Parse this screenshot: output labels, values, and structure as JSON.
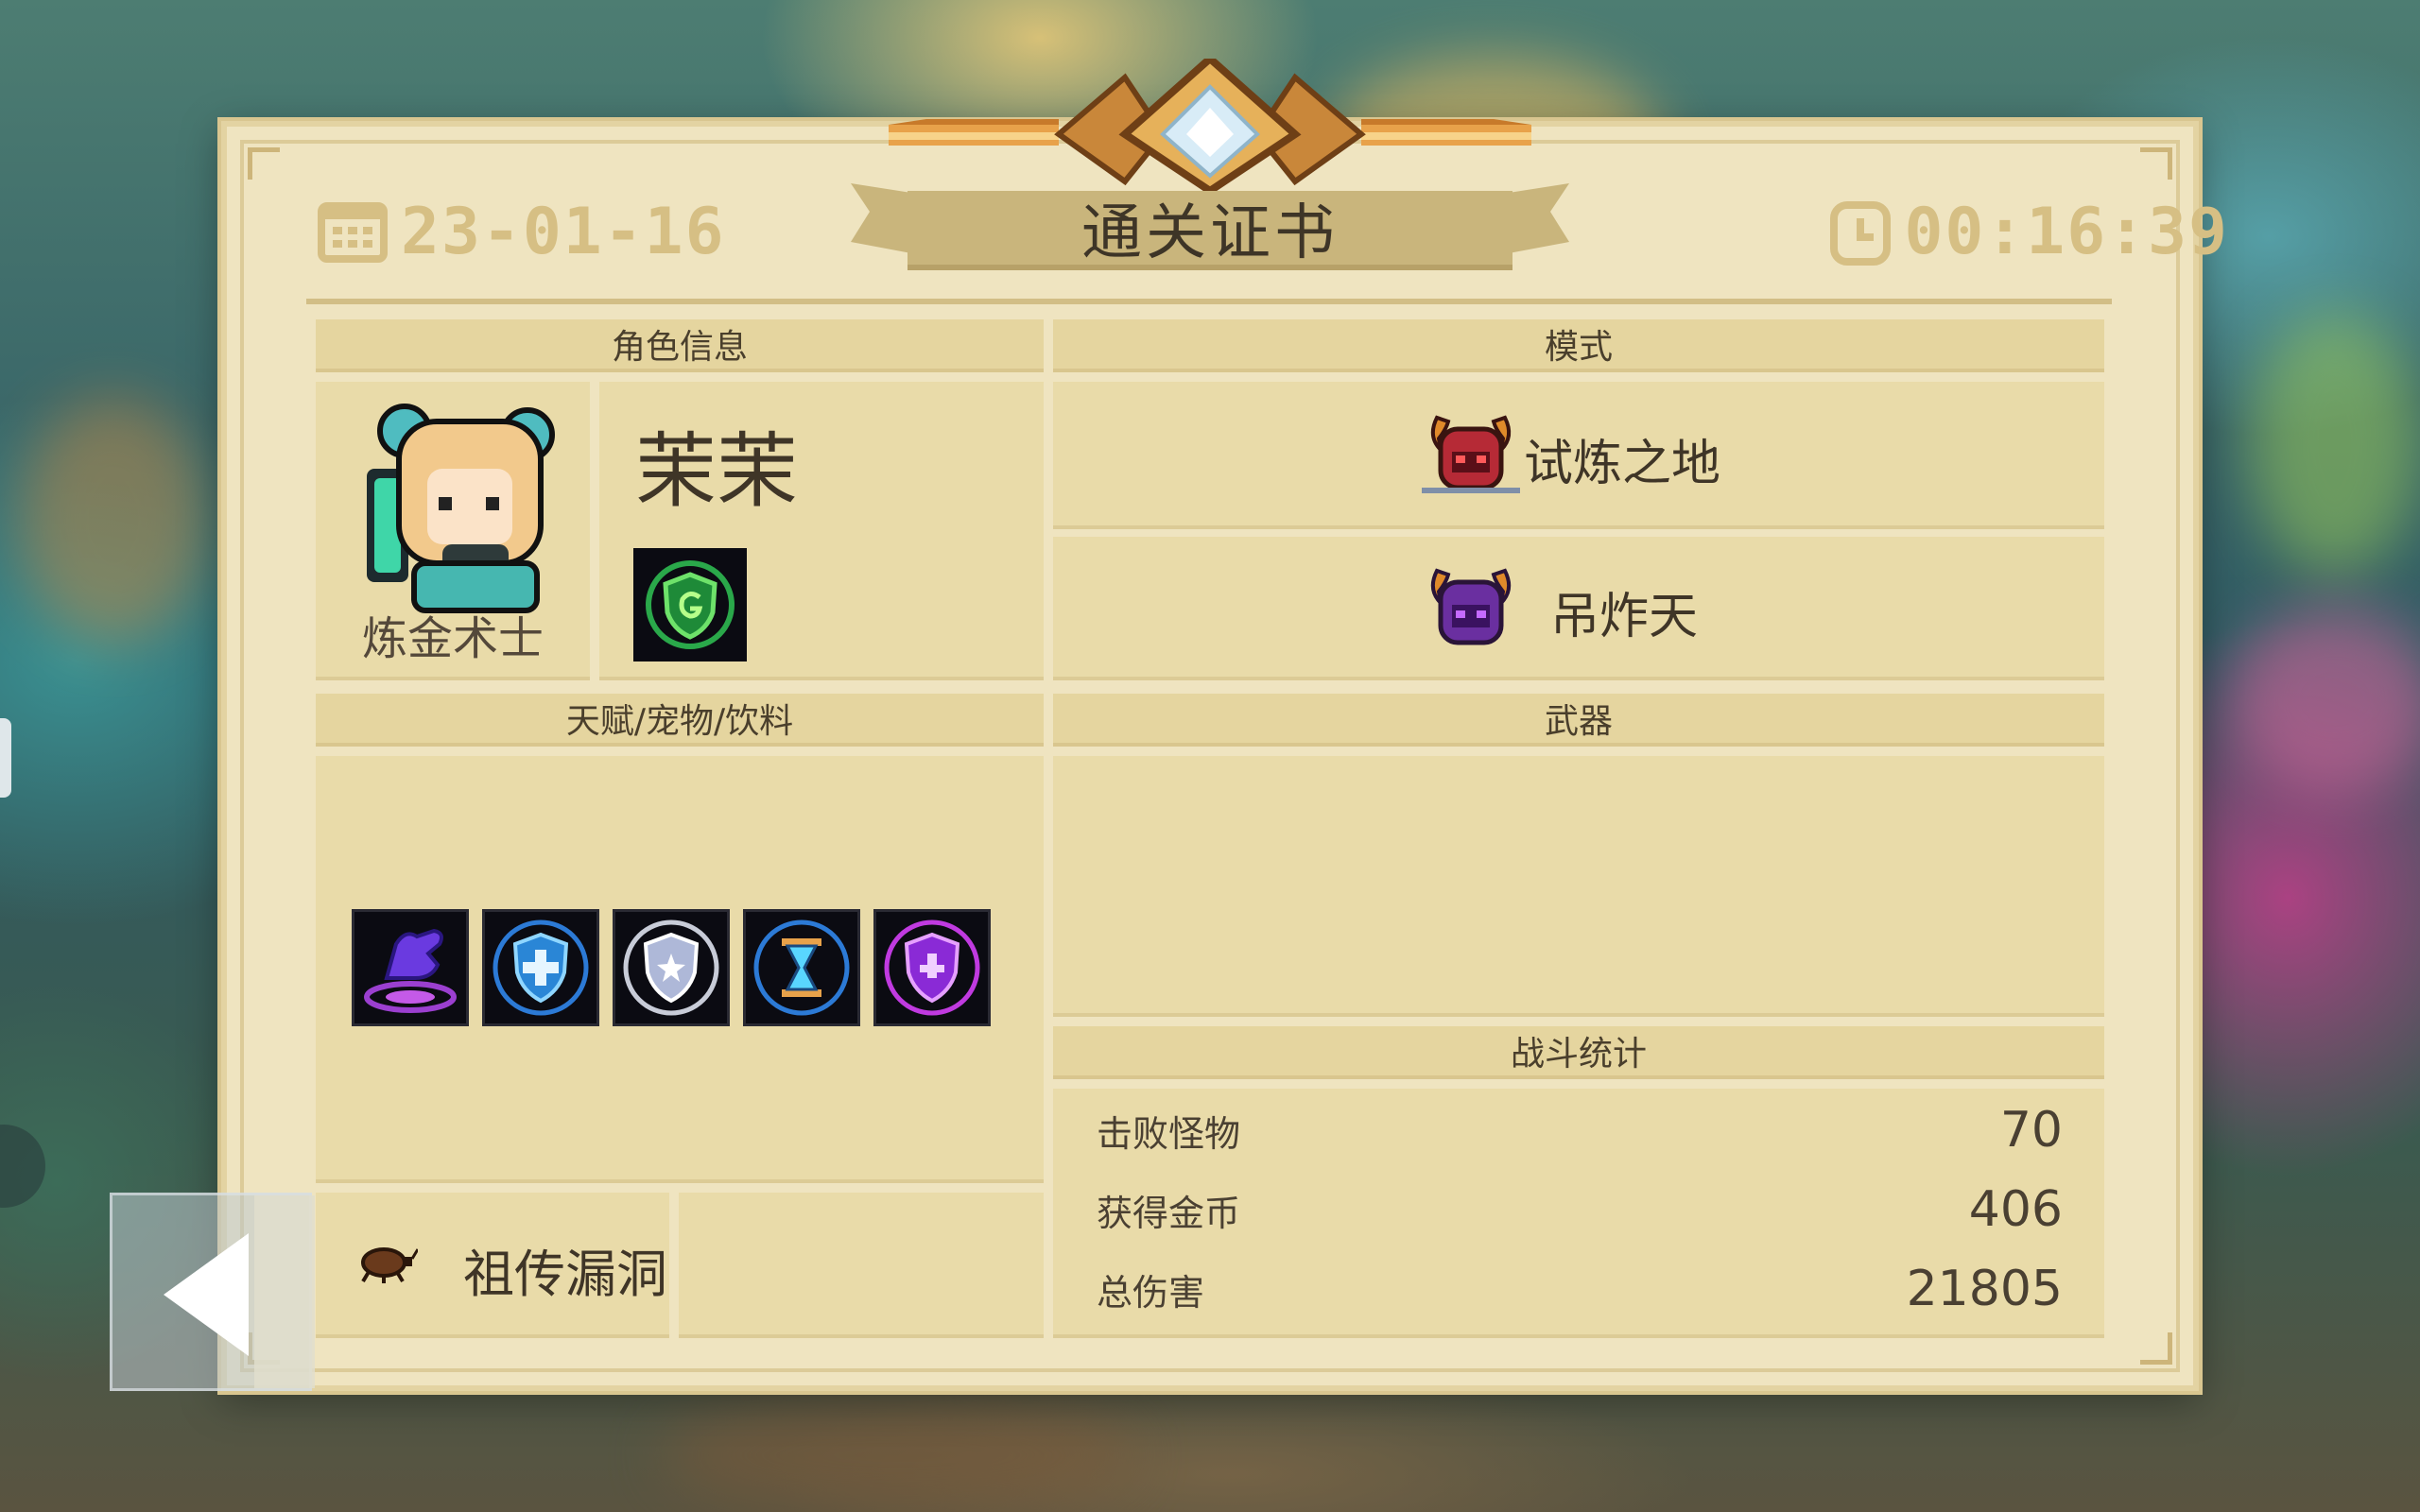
{
  "certificate": {
    "title": "通关证书",
    "date": "23-01-16",
    "time": "00:16:39",
    "date_icon": "calendar-icon",
    "time_icon": "clock-icon"
  },
  "character": {
    "section_title": "角色信息",
    "class_name": "炼金术士",
    "skin_name": "茉茉",
    "portrait_icon": "alchemist-portrait-icon",
    "skill_icon": "green-shield-skill-icon"
  },
  "mode": {
    "section_title": "模式",
    "items": [
      {
        "label": "试炼之地",
        "icon": "red-demon-helmet-icon"
      },
      {
        "label": "吊炸天",
        "icon": "purple-demon-helmet-icon"
      }
    ]
  },
  "talents": {
    "section_title": "天赋/宠物/饮料",
    "icons": [
      {
        "name": "purple-hand-portal-icon"
      },
      {
        "name": "blue-cross-shield-icon"
      },
      {
        "name": "white-star-shield-icon"
      },
      {
        "name": "hourglass-icon"
      },
      {
        "name": "purple-shield-icon"
      }
    ]
  },
  "weapons": {
    "section_title": "武器"
  },
  "relic": {
    "label": "祖传漏洞",
    "icon": "cockroach-icon"
  },
  "battle_stats": {
    "section_title": "战斗统计",
    "rows": [
      {
        "label": "击败怪物",
        "value": "70"
      },
      {
        "label": "获得金币",
        "value": "406"
      },
      {
        "label": "总伤害",
        "value": "21805"
      }
    ]
  },
  "colors": {
    "panel": "#efe4c0",
    "section_header": "#e5d59f",
    "cell": "#e9dba9",
    "accent_gold": "#d6bf84",
    "text_dark": "#3f3527"
  }
}
